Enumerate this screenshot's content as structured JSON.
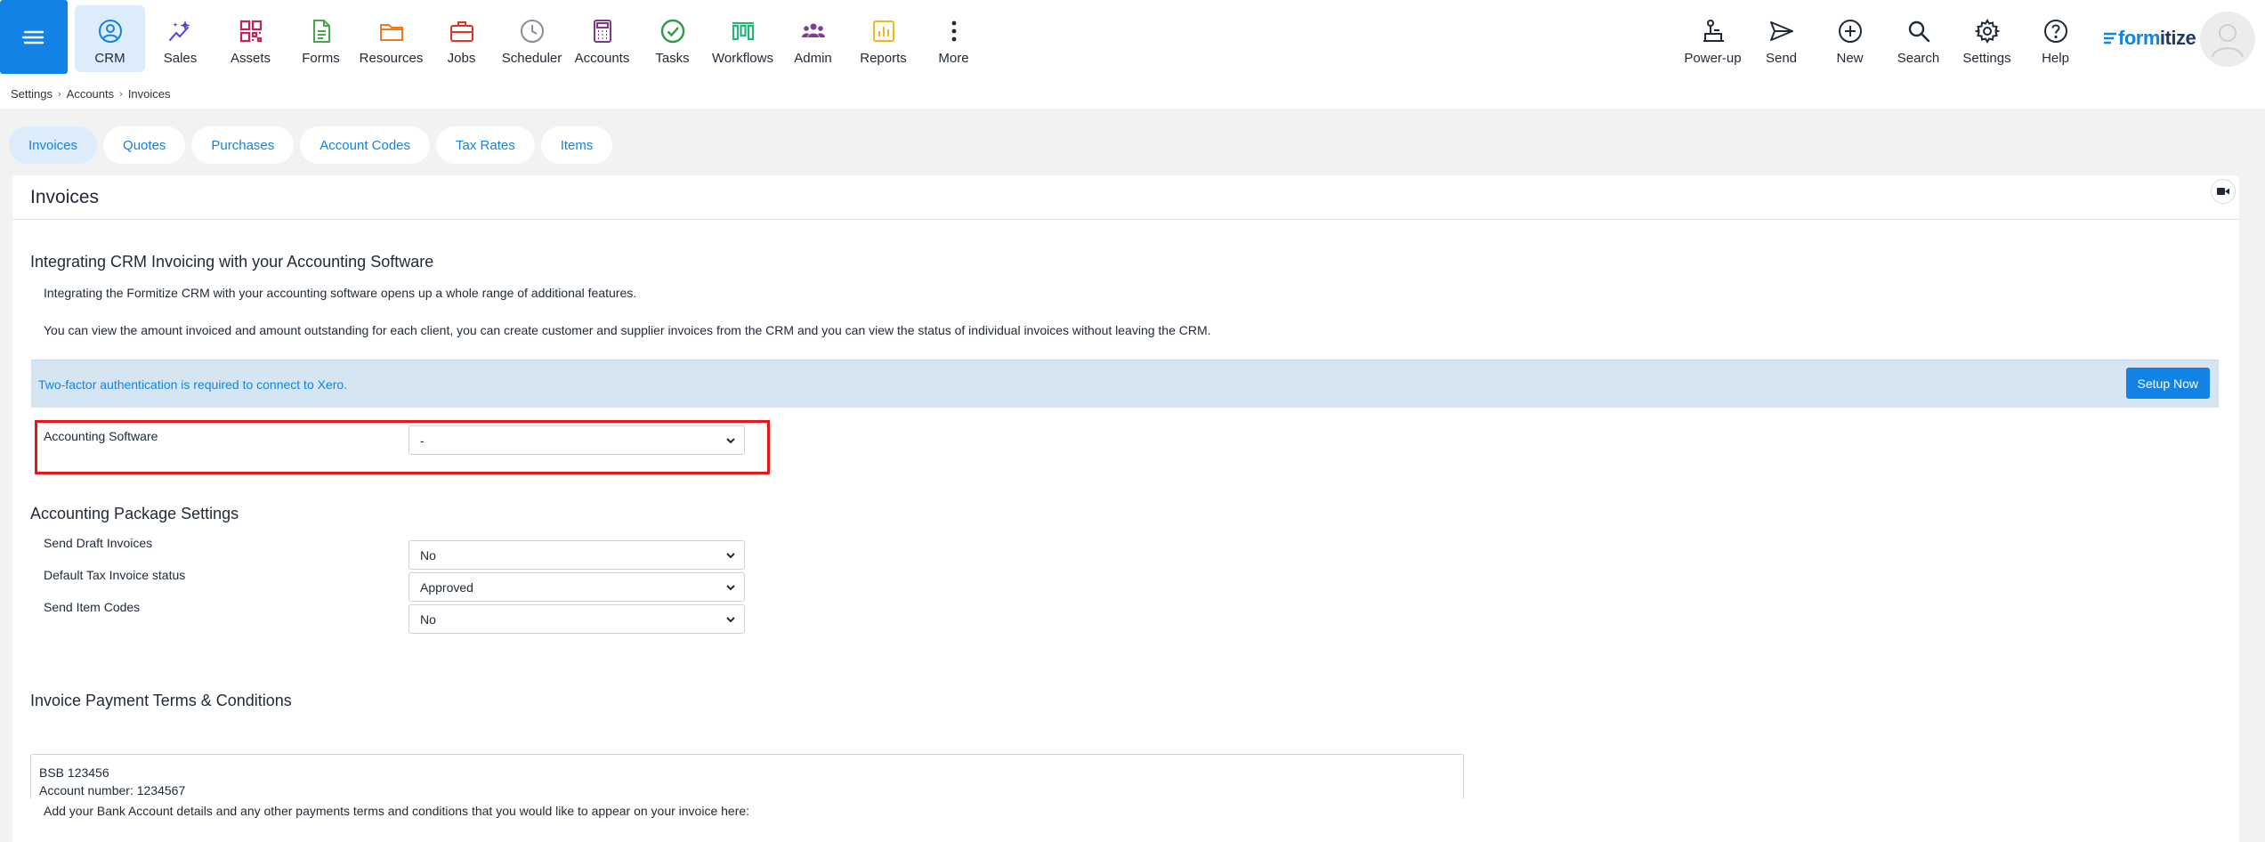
{
  "nav": {
    "items": [
      {
        "label": "CRM",
        "icon": "person-circle-icon",
        "color": "#1283e4",
        "active": true
      },
      {
        "label": "Sales",
        "icon": "sparkle-trend-icon",
        "color": "#5b3fd6"
      },
      {
        "label": "Assets",
        "icon": "qr-grid-icon",
        "color": "#c0235a"
      },
      {
        "label": "Forms",
        "icon": "document-icon",
        "color": "#44a845"
      },
      {
        "label": "Resources",
        "icon": "folder-icon",
        "color": "#f07a1e"
      },
      {
        "label": "Jobs",
        "icon": "briefcase-icon",
        "color": "#e2312d"
      },
      {
        "label": "Scheduler",
        "icon": "clock-icon",
        "color": "#8a8a9a"
      },
      {
        "label": "Accounts",
        "icon": "calculator-icon",
        "color": "#7d3a8c"
      },
      {
        "label": "Tasks",
        "icon": "check-circle-icon",
        "color": "#2e9c47"
      },
      {
        "label": "Workflows",
        "icon": "workflow-icon",
        "color": "#27b37a"
      },
      {
        "label": "Admin",
        "icon": "people-icon",
        "color": "#7e3d94"
      },
      {
        "label": "Reports",
        "icon": "bar-chart-icon",
        "color": "#f3b61e"
      },
      {
        "label": "More",
        "icon": "more-vertical-icon",
        "color": "#1f2937"
      }
    ],
    "right_items": [
      {
        "label": "Power-up",
        "icon": "power-up-icon"
      },
      {
        "label": "Send",
        "icon": "send-icon"
      },
      {
        "label": "New",
        "icon": "plus-circle-icon"
      },
      {
        "label": "Search",
        "icon": "search-icon"
      },
      {
        "label": "Settings",
        "icon": "gear-icon"
      },
      {
        "label": "Help",
        "icon": "help-icon"
      }
    ],
    "logo": {
      "prefix": "form",
      "suffix": "itize"
    }
  },
  "breadcrumb": [
    "Settings",
    "Accounts",
    "Invoices"
  ],
  "tabs": [
    {
      "label": "Invoices",
      "active": true
    },
    {
      "label": "Quotes"
    },
    {
      "label": "Purchases"
    },
    {
      "label": "Account Codes"
    },
    {
      "label": "Tax Rates"
    },
    {
      "label": "Items"
    }
  ],
  "panel": {
    "title": "Invoices"
  },
  "integration": {
    "heading": "Integrating CRM Invoicing with your Accounting Software",
    "para1": "Integrating the Formitize CRM with your accounting software opens up a whole range of additional features.",
    "para2": "You can view the amount invoiced and amount outstanding for each client, you can create customer and supplier invoices from the CRM and you can view the status of individual invoices without leaving the CRM.",
    "alert_text": "Two-factor authentication is required to connect to Xero.",
    "alert_button": "Setup Now",
    "software_label": "Accounting Software",
    "software_value": "-"
  },
  "package_settings": {
    "heading": "Accounting Package Settings",
    "fields": [
      {
        "label": "Send Draft Invoices",
        "value": "No"
      },
      {
        "label": "Default Tax Invoice status",
        "value": "Approved"
      },
      {
        "label": "Send Item Codes",
        "value": "No"
      }
    ]
  },
  "payment_terms": {
    "heading": "Invoice Payment Terms & Conditions",
    "description": "Add your Bank Account details and any other payments terms and conditions that you would like to appear on your invoice here:",
    "line1": "BSB 123456",
    "line2": "Account number: 1234567"
  },
  "colors": {
    "accent": "#1283e4",
    "highlight_border": "#e8161b",
    "alert_bg": "#d6e5f2"
  }
}
